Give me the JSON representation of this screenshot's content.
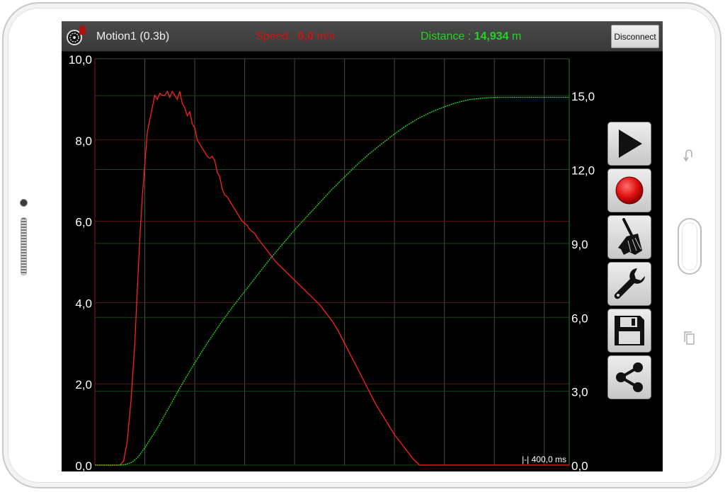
{
  "topbar": {
    "title": "Motion1 (0.3b)",
    "speed_label": "Speed : ",
    "speed_value": "0,0",
    "speed_unit": " m/s",
    "distance_label": "Distance : ",
    "distance_value": "14,934",
    "distance_unit": " m",
    "disconnect_label": "Disconnect"
  },
  "toolbar": {
    "play_icon": "play-icon",
    "record_icon": "record-icon",
    "clear_icon": "broom-icon",
    "settings_icon": "wrench-icon",
    "save_icon": "floppy-disk-icon",
    "share_icon": "share-icon"
  },
  "colors": {
    "speed": "#ff2020",
    "distance": "#20e020",
    "background": "#000000",
    "axis_text": "#ffffff"
  },
  "chart_data": {
    "type": "line",
    "title": "",
    "xlabel": "",
    "scale_label": "|-| 400,0 ms",
    "x_unit": "ms",
    "x_major_step": 400,
    "xlim": [
      0,
      3800
    ],
    "left_axis": {
      "ticks": [
        "0,0",
        "2,0",
        "4,0",
        "6,0",
        "8,0",
        "10,0"
      ],
      "ylim": [
        0,
        10
      ]
    },
    "right_axis": {
      "ticks": [
        "0,0",
        "3,0",
        "6,0",
        "9,0",
        "12,0",
        "15,0"
      ],
      "ylim": [
        0,
        16.5
      ]
    },
    "grid": true,
    "series": [
      {
        "name": "",
        "axis": "left",
        "color": "#ff2020",
        "x": [
          0,
          200,
          230,
          260,
          290,
          320,
          340,
          360,
          380,
          400,
          420,
          440,
          460,
          480,
          500,
          520,
          540,
          560,
          580,
          600,
          620,
          640,
          660,
          680,
          700,
          720,
          740,
          760,
          780,
          800,
          820,
          840,
          860,
          880,
          900,
          920,
          940,
          960,
          980,
          1000,
          1020,
          1040,
          1060,
          1080,
          1100,
          1120,
          1140,
          1160,
          1180,
          1200,
          1220,
          1240,
          1260,
          1280,
          1300,
          1350,
          1400,
          1450,
          1500,
          1550,
          1600,
          1650,
          1700,
          1750,
          1800,
          1850,
          1900,
          1950,
          2000,
          2050,
          2100,
          2150,
          2200,
          2250,
          2300,
          2350,
          2400,
          2450,
          2500,
          2550,
          2600,
          2650,
          2700,
          2750,
          2800,
          2850,
          2900,
          2950,
          3000,
          3050,
          3100,
          3150,
          3200,
          3250,
          3300,
          3350,
          3400,
          3450,
          3500,
          3550,
          3600,
          3650,
          3700,
          3750,
          3800
        ],
        "values": [
          0,
          0,
          0.1,
          0.6,
          1.6,
          3.0,
          4.3,
          5.6,
          6.6,
          7.4,
          8.2,
          8.5,
          8.8,
          9.1,
          9.0,
          9.15,
          9.1,
          9.1,
          9.2,
          9.05,
          9.2,
          9.1,
          9.0,
          9.2,
          8.9,
          8.8,
          8.6,
          8.7,
          8.4,
          8.3,
          8.0,
          7.9,
          7.8,
          7.7,
          7.6,
          7.55,
          7.6,
          7.5,
          7.2,
          7.1,
          6.8,
          6.65,
          6.6,
          6.5,
          6.4,
          6.3,
          6.2,
          6.1,
          6.0,
          5.95,
          5.9,
          5.8,
          5.75,
          5.7,
          5.6,
          5.4,
          5.2,
          5.0,
          4.85,
          4.7,
          4.55,
          4.4,
          4.25,
          4.1,
          3.95,
          3.75,
          3.55,
          3.3,
          3.0,
          2.7,
          2.4,
          2.1,
          1.8,
          1.5,
          1.25,
          1.0,
          0.75,
          0.55,
          0.35,
          0.15,
          0,
          0,
          0,
          0,
          0,
          0,
          0,
          0,
          0,
          0,
          0,
          0,
          0,
          0,
          0,
          0,
          0,
          0,
          0,
          0,
          0,
          0,
          0,
          0,
          0
        ]
      },
      {
        "name": "",
        "axis": "right",
        "color": "#20e020",
        "x": [
          0,
          200,
          250,
          300,
          350,
          400,
          450,
          500,
          600,
          700,
          800,
          900,
          1000,
          1100,
          1200,
          1300,
          1400,
          1500,
          1600,
          1700,
          1800,
          1900,
          2000,
          2100,
          2200,
          2300,
          2400,
          2500,
          2600,
          2700,
          2800,
          2900,
          3000,
          3100,
          3200,
          3300,
          3400,
          3500,
          3600,
          3700,
          3800
        ],
        "values": [
          0,
          0,
          0.03,
          0.12,
          0.35,
          0.7,
          1.1,
          1.5,
          2.4,
          3.3,
          4.15,
          4.95,
          5.7,
          6.4,
          7.05,
          7.7,
          8.35,
          8.95,
          9.55,
          10.1,
          10.65,
          11.2,
          11.7,
          12.2,
          12.65,
          13.05,
          13.45,
          13.8,
          14.1,
          14.35,
          14.55,
          14.72,
          14.84,
          14.9,
          14.93,
          14.934,
          14.934,
          14.934,
          14.934,
          14.934,
          14.934
        ]
      }
    ]
  }
}
